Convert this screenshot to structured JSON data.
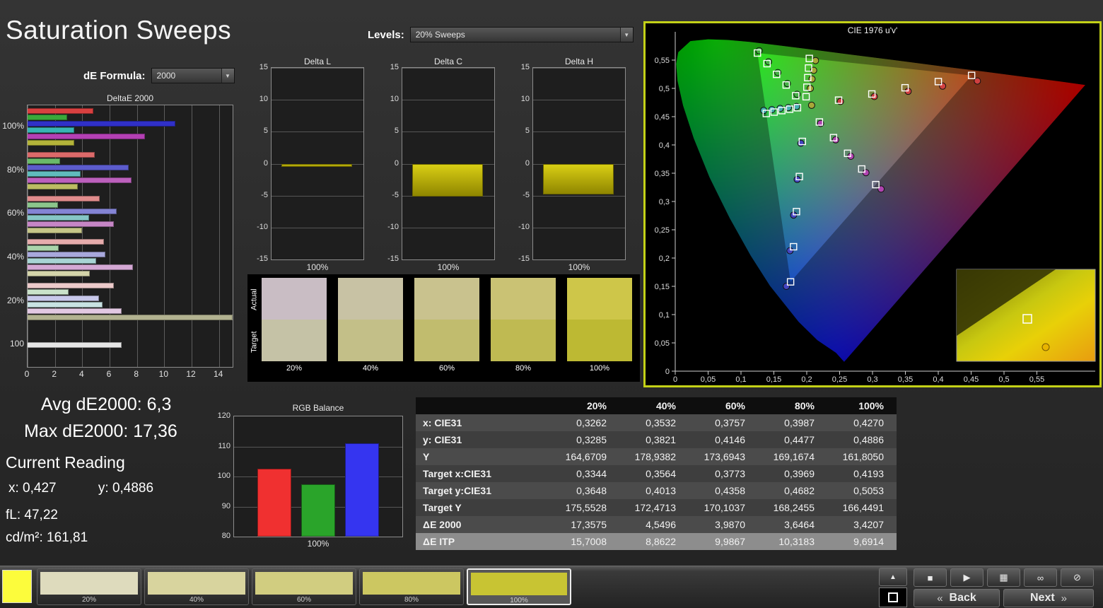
{
  "page": {
    "title": "Saturation Sweeps"
  },
  "levels": {
    "label": "Levels:",
    "value": "20% Sweeps"
  },
  "de_formula": {
    "label": "dE Formula:",
    "value": "2000"
  },
  "stats": {
    "avg": "Avg dE2000: 6,3",
    "max": "Max dE2000: 17,36"
  },
  "current_reading": {
    "title": "Current Reading",
    "x": "x: 0,427",
    "y": "y: 0,4886",
    "fl": "fL: 47,22",
    "cdm2": "cd/m²: 161,81"
  },
  "chart_data": [
    {
      "id": "deltae2000",
      "type": "bar",
      "orientation": "horizontal",
      "title": "DeltaE 2000",
      "xlim": [
        0,
        15
      ],
      "xticks": [
        0,
        2,
        4,
        6,
        8,
        10,
        12,
        14
      ],
      "groups": [
        {
          "label": "100%",
          "bars": [
            {
              "name": "red",
              "v": 4.8,
              "c": "#d84040"
            },
            {
              "name": "green",
              "v": 2.9,
              "c": "#3aa83a"
            },
            {
              "name": "blue",
              "v": 10.8,
              "c": "#3030c8"
            },
            {
              "name": "cyan",
              "v": 3.4,
              "c": "#38b4b4"
            },
            {
              "name": "magenta",
              "v": 8.6,
              "c": "#b440b4"
            },
            {
              "name": "yellow",
              "v": 3.42,
              "c": "#b4b43a"
            }
          ]
        },
        {
          "label": "80%",
          "bars": [
            {
              "name": "red",
              "v": 4.9,
              "c": "#dc6a6a"
            },
            {
              "name": "green",
              "v": 2.4,
              "c": "#6aba6a"
            },
            {
              "name": "blue",
              "v": 7.4,
              "c": "#5c5ccc"
            },
            {
              "name": "cyan",
              "v": 3.9,
              "c": "#60bcbc"
            },
            {
              "name": "magenta",
              "v": 7.6,
              "c": "#bc60bc"
            },
            {
              "name": "yellow",
              "v": 3.65,
              "c": "#bcbc62"
            }
          ]
        },
        {
          "label": "60%",
          "bars": [
            {
              "name": "red",
              "v": 5.3,
              "c": "#e08c8c"
            },
            {
              "name": "green",
              "v": 2.2,
              "c": "#8cc68c"
            },
            {
              "name": "blue",
              "v": 6.5,
              "c": "#8484d4"
            },
            {
              "name": "cyan",
              "v": 4.5,
              "c": "#86c6c6"
            },
            {
              "name": "magenta",
              "v": 6.3,
              "c": "#c686c6"
            },
            {
              "name": "yellow",
              "v": 3.99,
              "c": "#c6c688"
            }
          ]
        },
        {
          "label": "40%",
          "bars": [
            {
              "name": "red",
              "v": 5.6,
              "c": "#e6acac"
            },
            {
              "name": "green",
              "v": 2.3,
              "c": "#aad4aa"
            },
            {
              "name": "blue",
              "v": 5.7,
              "c": "#a8a8dc"
            },
            {
              "name": "cyan",
              "v": 5.0,
              "c": "#a8d4d4"
            },
            {
              "name": "magenta",
              "v": 7.7,
              "c": "#d4a8d4"
            },
            {
              "name": "yellow",
              "v": 4.55,
              "c": "#d4d4aa"
            }
          ]
        },
        {
          "label": "20%",
          "bars": [
            {
              "name": "red",
              "v": 6.3,
              "c": "#eccaca"
            },
            {
              "name": "green",
              "v": 3.0,
              "c": "#cae2ca"
            },
            {
              "name": "blue",
              "v": 5.2,
              "c": "#c8c8ea"
            },
            {
              "name": "cyan",
              "v": 5.5,
              "c": "#c8e2e2"
            },
            {
              "name": "magenta",
              "v": 6.9,
              "c": "#e2c8e2"
            },
            {
              "name": "yellow",
              "v": 17.36,
              "c": "#b2b290"
            }
          ]
        },
        {
          "label": "100",
          "bars": [
            {
              "name": "white",
              "v": 6.9,
              "c": "#e6e6e6"
            }
          ]
        }
      ]
    },
    {
      "id": "delta_l",
      "type": "bar",
      "title": "Delta L",
      "ylim": [
        -15,
        15
      ],
      "yticks": [
        15,
        10,
        5,
        0,
        -5,
        -10,
        -15
      ],
      "categories": [
        "100%"
      ],
      "values": [
        -0.5
      ],
      "bar_color": "#c9bf0a"
    },
    {
      "id": "delta_c",
      "type": "bar",
      "title": "Delta C",
      "ylim": [
        -15,
        15
      ],
      "yticks": [
        15,
        10,
        5,
        0,
        -5,
        -10,
        -15
      ],
      "categories": [
        "100%"
      ],
      "values": [
        -5.2
      ],
      "bar_color": "#c9bf0a"
    },
    {
      "id": "delta_h",
      "type": "bar",
      "title": "Delta H",
      "ylim": [
        -15,
        15
      ],
      "yticks": [
        15,
        10,
        5,
        0,
        -5,
        -10,
        -15
      ],
      "categories": [
        "100%"
      ],
      "values": [
        -4.8
      ],
      "bar_color": "#c9bf0a"
    },
    {
      "id": "rgb_balance",
      "type": "bar",
      "title": "RGB Balance",
      "ylim": [
        80,
        120
      ],
      "yticks": [
        120,
        110,
        100,
        90,
        80
      ],
      "categories": [
        "100%"
      ],
      "series": [
        {
          "name": "Red",
          "value": 102.5,
          "color": "#f03030"
        },
        {
          "name": "Green",
          "value": 97.5,
          "color": "#2aa42a"
        },
        {
          "name": "Blue",
          "value": 111.0,
          "color": "#3535f0"
        }
      ]
    },
    {
      "id": "cie_uv",
      "type": "scatter",
      "title": "CIE 1976 u'v'",
      "xlim": [
        0,
        0.6
      ],
      "ylim": [
        0,
        0.6
      ],
      "ticks": [
        0,
        0.05,
        0.1,
        0.15,
        0.2,
        0.25,
        0.3,
        0.35,
        0.4,
        0.45,
        0.5,
        0.55
      ],
      "tick_labels": [
        "0",
        "0,05",
        "0,1",
        "0,15",
        "0,2",
        "0,25",
        "0,3",
        "0,35",
        "0,4",
        "0,45",
        "0,5",
        "0,55"
      ],
      "white_point": [
        0.1978,
        0.4683
      ],
      "colors": {
        "red": "#d04040",
        "green": "#44b044",
        "blue": "#4444c0",
        "cyan": "#44b0b0",
        "magenta": "#b044b0",
        "yellow": "#a8a838"
      },
      "targets": {
        "red": [
          [
            0.2484,
            0.4792
          ],
          [
            0.299,
            0.4901
          ],
          [
            0.3495,
            0.5011
          ],
          [
            0.4001,
            0.512
          ],
          [
            0.4507,
            0.5229
          ]
        ],
        "green": [
          [
            0.1832,
            0.4871
          ],
          [
            0.1687,
            0.506
          ],
          [
            0.1541,
            0.5248
          ],
          [
            0.1396,
            0.5437
          ],
          [
            0.125,
            0.5625
          ]
        ],
        "blue": [
          [
            0.1933,
            0.4062
          ],
          [
            0.1888,
            0.3441
          ],
          [
            0.1844,
            0.2821
          ],
          [
            0.1799,
            0.22
          ],
          [
            0.1754,
            0.1579
          ]
        ],
        "cyan": [
          [
            0.1859,
            0.4658
          ],
          [
            0.1741,
            0.4632
          ],
          [
            0.1622,
            0.4607
          ],
          [
            0.1504,
            0.4581
          ],
          [
            0.1385,
            0.4556
          ]
        ],
        "magenta": [
          [
            0.2192,
            0.4406
          ],
          [
            0.2407,
            0.4129
          ],
          [
            0.2621,
            0.3852
          ],
          [
            0.2836,
            0.3575
          ],
          [
            0.305,
            0.3298
          ]
        ],
        "yellow": [
          [
            0.199,
            0.4852
          ],
          [
            0.2002,
            0.5021
          ],
          [
            0.2015,
            0.519
          ],
          [
            0.2027,
            0.536
          ],
          [
            0.2039,
            0.5529
          ]
        ]
      },
      "measured": {
        "red": [
          [
            0.2512,
            0.4768
          ],
          [
            0.3028,
            0.4856
          ],
          [
            0.3542,
            0.4948
          ],
          [
            0.4066,
            0.504
          ],
          [
            0.4595,
            0.513
          ]
        ],
        "green": [
          [
            0.1852,
            0.4896
          ],
          [
            0.1705,
            0.5085
          ],
          [
            0.156,
            0.528
          ],
          [
            0.1418,
            0.547
          ],
          [
            0.1276,
            0.5665
          ]
        ],
        "blue": [
          [
            0.191,
            0.403
          ],
          [
            0.1855,
            0.339
          ],
          [
            0.18,
            0.276
          ],
          [
            0.1745,
            0.213
          ],
          [
            0.169,
            0.15
          ]
        ],
        "cyan": [
          [
            0.1845,
            0.468
          ],
          [
            0.172,
            0.466
          ],
          [
            0.1595,
            0.4645
          ],
          [
            0.147,
            0.4625
          ],
          [
            0.1345,
            0.461
          ]
        ],
        "magenta": [
          [
            0.221,
            0.438
          ],
          [
            0.244,
            0.409
          ],
          [
            0.267,
            0.38
          ],
          [
            0.29,
            0.351
          ],
          [
            0.313,
            0.322
          ]
        ],
        "yellow": [
          [
            0.2074,
            0.4701
          ],
          [
            0.2054,
            0.4999
          ],
          [
            0.208,
            0.5165
          ],
          [
            0.2105,
            0.5319
          ],
          [
            0.2133,
            0.5491
          ]
        ]
      }
    }
  ],
  "swatches": {
    "actual_label": "Actual",
    "target_label": "Target",
    "items": [
      {
        "label": "20%",
        "actual": "#c9bdc4",
        "target": "#c5c2a6"
      },
      {
        "label": "40%",
        "actual": "#c8c2a4",
        "target": "#c3bf88"
      },
      {
        "label": "60%",
        "actual": "#c9c28e",
        "target": "#c1bc6e"
      },
      {
        "label": "80%",
        "actual": "#cac274",
        "target": "#bfba52"
      },
      {
        "label": "100%",
        "actual": "#cec649",
        "target": "#bdb933"
      }
    ]
  },
  "table": {
    "columns": [
      "20%",
      "40%",
      "60%",
      "80%",
      "100%"
    ],
    "rows": [
      {
        "label": "x: CIE31",
        "values": [
          "0,3262",
          "0,3532",
          "0,3757",
          "0,3987",
          "0,4270"
        ]
      },
      {
        "label": "y: CIE31",
        "values": [
          "0,3285",
          "0,3821",
          "0,4146",
          "0,4477",
          "0,4886"
        ]
      },
      {
        "label": "Y",
        "values": [
          "164,6709",
          "178,9382",
          "173,6943",
          "169,1674",
          "161,8050"
        ]
      },
      {
        "label": "Target x:CIE31",
        "values": [
          "0,3344",
          "0,3564",
          "0,3773",
          "0,3969",
          "0,4193"
        ]
      },
      {
        "label": "Target y:CIE31",
        "values": [
          "0,3648",
          "0,4013",
          "0,4358",
          "0,4682",
          "0,5053"
        ]
      },
      {
        "label": "Target Y",
        "values": [
          "175,5528",
          "172,4713",
          "170,1037",
          "168,2455",
          "166,4491"
        ]
      },
      {
        "label": "ΔE 2000",
        "values": [
          "17,3575",
          "4,5496",
          "3,9870",
          "3,6464",
          "3,4207"
        ]
      },
      {
        "label": "ΔE ITP",
        "values": [
          "15,7008",
          "8,8622",
          "9,9867",
          "10,3183",
          "9,6914"
        ],
        "highlight": true
      }
    ]
  },
  "bottom_bar": {
    "current_color": "#fcfc3c",
    "strips": [
      {
        "label": "20%",
        "color": "#dedbbd",
        "selected": false
      },
      {
        "label": "40%",
        "color": "#d8d49e",
        "selected": false
      },
      {
        "label": "60%",
        "color": "#d1cd80",
        "selected": false
      },
      {
        "label": "80%",
        "color": "#ccc761",
        "selected": false
      },
      {
        "label": "100%",
        "color": "#c8c433",
        "selected": true
      }
    ],
    "icons": [
      {
        "name": "stop-icon",
        "glyph": "■"
      },
      {
        "name": "play-icon",
        "glyph": "▶"
      },
      {
        "name": "pattern-icon",
        "glyph": "▦"
      },
      {
        "name": "continuous-icon",
        "glyph": "∞"
      },
      {
        "name": "power-icon",
        "glyph": "⊘"
      }
    ],
    "up_icon": {
      "name": "arrow-up-icon",
      "glyph": "▲"
    },
    "back_label": "Back",
    "next_label": "Next",
    "chevron_back": "«",
    "chevron_next": "»"
  }
}
